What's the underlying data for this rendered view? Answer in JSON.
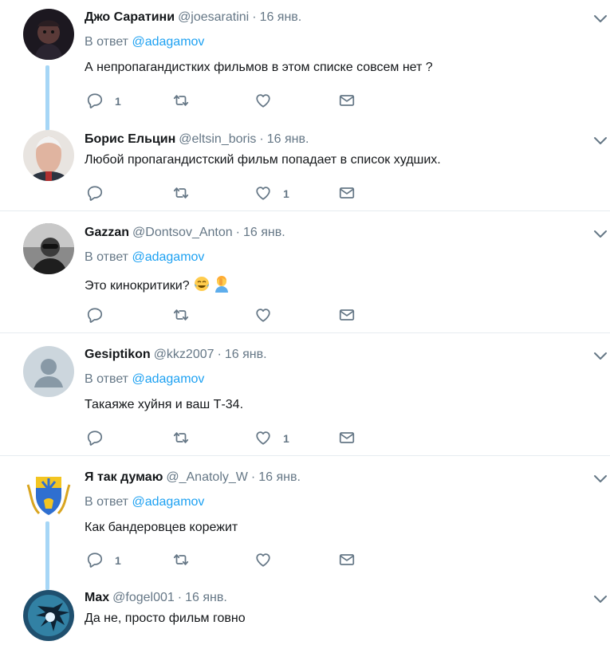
{
  "tweets": [
    {
      "name": "Джо Саратини",
      "handle": "@joesaratini",
      "date": "16 янв.",
      "reply_prefix": "В ответ",
      "reply_to": "@adagamov",
      "text": "А непропагандистких фильмов в этом списке совсем нет ?",
      "reply_count": "1",
      "like_count": ""
    },
    {
      "name": "Борис Ельцин",
      "handle": "@eltsin_boris",
      "date": "16 янв.",
      "text": "Любой пропагандистский фильм попадает в список худших.",
      "reply_count": "",
      "like_count": "1"
    },
    {
      "name": "Gazzan",
      "handle": "@Dontsov_Anton",
      "date": "16 янв.",
      "reply_prefix": "В ответ",
      "reply_to": "@adagamov",
      "text": "Это кинокритики?",
      "reply_count": "",
      "like_count": ""
    },
    {
      "name": "Gesiptikon",
      "handle": "@kkz2007",
      "date": "16 янв.",
      "reply_prefix": "В ответ",
      "reply_to": "@adagamov",
      "text": "Такаяже хуйня и ваш Т-34.",
      "reply_count": "",
      "like_count": "1"
    },
    {
      "name": "Я так думаю",
      "handle": "@_Anatoly_W",
      "date": "16 янв.",
      "reply_prefix": "В ответ",
      "reply_to": "@adagamov",
      "text": "Как бандеровцев корежит",
      "reply_count": "1",
      "like_count": ""
    },
    {
      "name": "Max",
      "handle": "@fogel001",
      "date": "16 янв.",
      "text": "Да не, просто фильм говно"
    }
  ],
  "icons": {
    "reply": "reply-icon",
    "retweet": "retweet-icon",
    "like": "heart-icon",
    "dm": "envelope-icon",
    "more": "chevron-down-icon",
    "emojis": [
      "face-with-tears-of-joy-emoji",
      "person-facepalming-emoji"
    ]
  },
  "colors": {
    "text": "#14171a",
    "muted": "#657786",
    "link": "#1da1f2",
    "thread": "#a6d6f6",
    "separator": "#e6ecf0"
  }
}
